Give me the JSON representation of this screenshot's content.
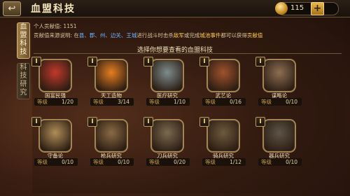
{
  "header": {
    "back_icon": "back-arrow-icon",
    "title": "血盟科技",
    "coins": "115",
    "add_label": "+"
  },
  "tabs": [
    {
      "label": "血盟科技",
      "active": true
    },
    {
      "label": "科技研究",
      "active": false
    }
  ],
  "info": {
    "contribution_label": "个人贡献值:",
    "contribution_value": "1151",
    "source_prefix": "贡献值来源说明: 在",
    "source_blue_1": "县、郡、州、边关、王城",
    "source_mid": "进行战斗时击杀",
    "source_gold_1": "敌军",
    "source_mid2": "或完成",
    "source_gold_2": "城池事件",
    "source_suffix": "都可以获得",
    "source_gold_3": "贡献值"
  },
  "section_title": "选择你想要查看的血盟科技",
  "lock_glyph": "I",
  "level_label": "等级",
  "technologies": [
    {
      "name": "国富民强",
      "level": "1/20",
      "icon": "warrior-portrait-icon",
      "color": "#c0392b"
    },
    {
      "name": "天工造物",
      "level": "3/14",
      "icon": "forge-icon",
      "color": "#e67e22"
    },
    {
      "name": "医疗研究",
      "level": "1/10",
      "icon": "scholar-portrait-icon",
      "color": "#7f8c8d"
    },
    {
      "name": "武艺论",
      "level": "0/16",
      "icon": "general-portrait-icon",
      "color": "#a0522d"
    },
    {
      "name": "谋略论",
      "level": "0/10",
      "icon": "strategist-portrait-icon",
      "color": "#8e6e53"
    },
    {
      "name": "守备论",
      "level": "0/10",
      "icon": "great-wall-icon",
      "color": "#b08d57"
    },
    {
      "name": "枪兵研究",
      "level": "0/10",
      "icon": "crossed-spears-icon",
      "color": "#8a6a44"
    },
    {
      "name": "刀兵研究",
      "level": "0/20",
      "icon": "crossed-swords-icon",
      "color": "#7a6a50"
    },
    {
      "name": "骑兵研究",
      "level": "1/12",
      "icon": "cavalry-icon",
      "color": "#6f5a3e"
    },
    {
      "name": "器兵研究",
      "level": "0/10",
      "icon": "siege-cannon-icon",
      "color": "#5e5448"
    }
  ]
}
